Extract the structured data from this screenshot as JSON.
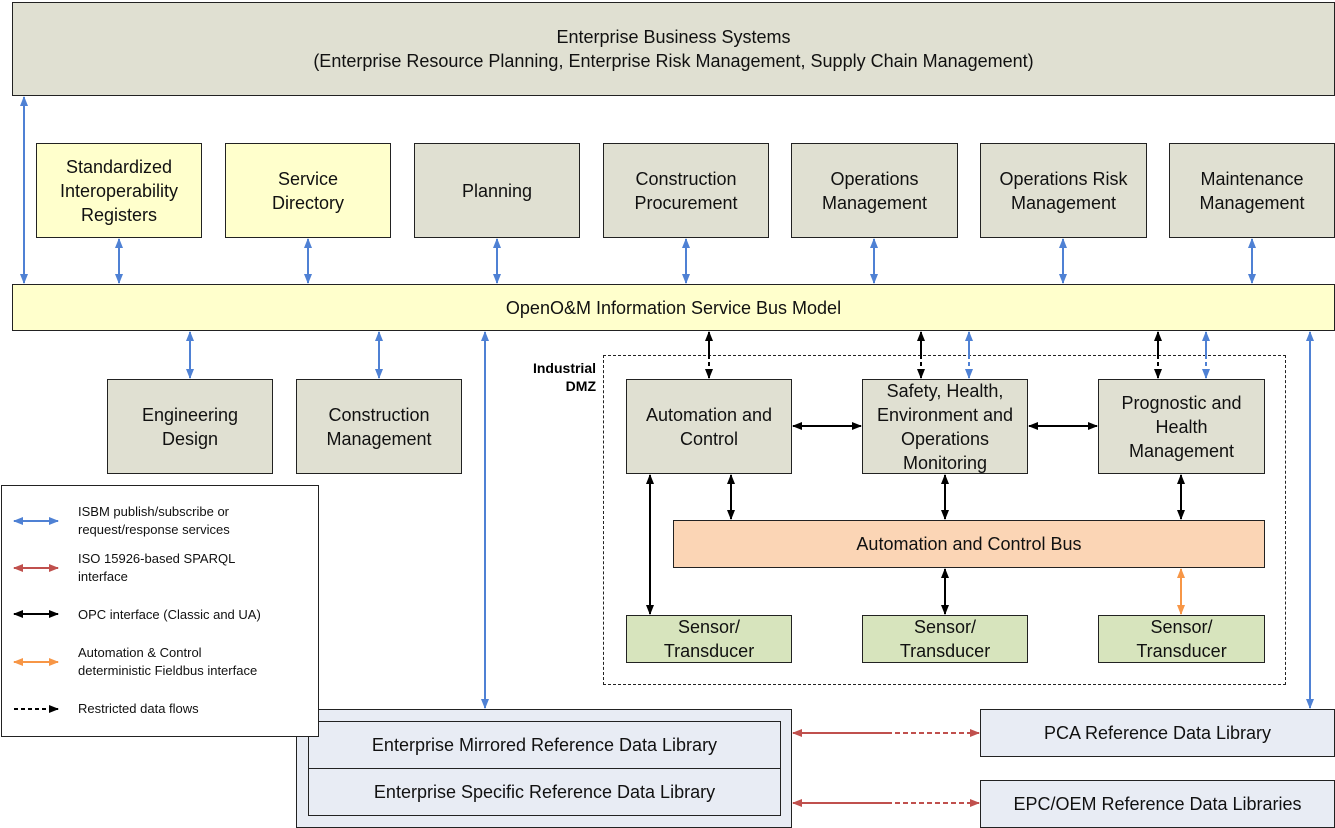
{
  "top": {
    "title": "Enterprise Business Systems",
    "subtitle": "(Enterprise Resource Planning, Enterprise Risk Management, Supply Chain Management)"
  },
  "row": [
    "Standardized\nInteroperability\nRegisters",
    "Service\nDirectory",
    "Planning",
    "Construction\nProcurement",
    "Operations\nManagement",
    "Operations Risk\nManagement",
    "Maintenance\nManagement"
  ],
  "bus": "OpenO&M Information Service Bus Model",
  "lower": [
    "Engineering\nDesign",
    "Construction\nManagement"
  ],
  "dmz": {
    "label": "Industrial\nDMZ",
    "blocks": [
      "Automation and\nControl",
      "Safety, Health,\nEnvironment and\nOperations\nMonitoring",
      "Prognostic and\nHealth\nManagement"
    ],
    "bus": "Automation and Control Bus",
    "sensors": [
      "Sensor/\nTransducer",
      "Sensor/\nTransducer",
      "Sensor/\nTransducer"
    ]
  },
  "libraries": {
    "mirrored": "Enterprise Mirrored Reference Data Library",
    "specific": "Enterprise Specific Reference Data Library",
    "pca": "PCA Reference Data Library",
    "epc": "EPC/OEM Reference Data Libraries"
  },
  "legend": [
    "ISBM publish/subscribe or\nrequest/response services",
    "ISO 15926-based SPARQL\ninterface",
    "OPC interface (Classic and UA)",
    "Automation & Control\ndeterministic Fieldbus interface",
    "Restricted data flows"
  ],
  "colors": {
    "isbm": "#4f81d4",
    "sparql": "#c0504d",
    "opc": "#000000",
    "fieldbus": "#f79646",
    "gray": "#e0e0d2",
    "yellow": "#ffffcc"
  }
}
